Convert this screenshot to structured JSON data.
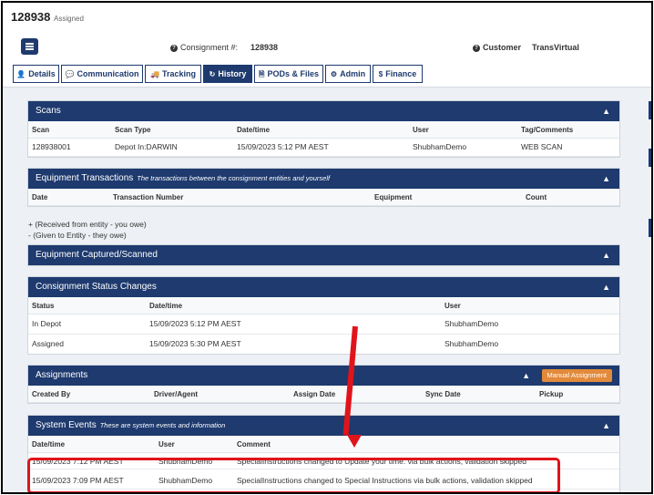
{
  "header": {
    "consignment_id": "128938",
    "status": "Assigned",
    "consignment_label": "Consignment #:",
    "consignment_value": "128938",
    "customer_label": "Customer",
    "customer_value": "TransVirtual"
  },
  "tabs": [
    {
      "icon": "user-icon",
      "glyph": "👤",
      "label": "Details"
    },
    {
      "icon": "chat-icon",
      "glyph": "💬",
      "label": "Communication"
    },
    {
      "icon": "truck-icon",
      "glyph": "🚚",
      "label": "Tracking"
    },
    {
      "icon": "history-icon",
      "glyph": "↻",
      "label": "History"
    },
    {
      "icon": "document-icon",
      "glyph": "🗎",
      "label": "PODs & Files"
    },
    {
      "icon": "gear-icon",
      "glyph": "⚙",
      "label": "Admin"
    },
    {
      "icon": "dollar-icon",
      "glyph": "$",
      "label": "Finance"
    }
  ],
  "active_tab": "History",
  "scans": {
    "title": "Scans",
    "columns": [
      "Scan",
      "Scan Type",
      "Date/time",
      "User",
      "Tag/Comments"
    ],
    "rows": [
      [
        "128938001",
        "Depot In:DARWIN",
        "15/09/2023 5:12 PM AEST",
        "ShubhamDemo",
        "WEB SCAN"
      ]
    ]
  },
  "equipment": {
    "title": "Equipment Transactions",
    "subtitle": "The transactions between the consignment entities and yourself",
    "columns": [
      "Date",
      "Transaction Number",
      "Equipment",
      "Count"
    ]
  },
  "notes": {
    "received": "+ (Received from entity - you owe)",
    "given": "- (Given to Entity - they owe)"
  },
  "equipment_captured": {
    "title": "Equipment Captured/Scanned"
  },
  "status_changes": {
    "title": "Consignment Status Changes",
    "columns": [
      "Status",
      "Date/time",
      "User"
    ],
    "rows": [
      [
        "In Depot",
        "15/09/2023 5:12 PM AEST",
        "ShubhamDemo"
      ],
      [
        "Assigned",
        "15/09/2023 5:30 PM AEST",
        "ShubhamDemo"
      ]
    ]
  },
  "assignments": {
    "title": "Assignments",
    "button": "Manual Assignment",
    "columns": [
      "Created By",
      "Driver/Agent",
      "Assign Date",
      "Sync Date",
      "Pickup"
    ]
  },
  "system_events": {
    "title": "System Events",
    "subtitle": "These are system events and information",
    "columns": [
      "Date/time",
      "User",
      "Comment"
    ],
    "rows": [
      [
        "15/09/2023 7:12 PM AEST",
        "ShubhamDemo",
        "SpecialInstructions changed to Update your time. via bulk actions, validation skipped"
      ],
      [
        "15/09/2023 7:09 PM AEST",
        "ShubhamDemo",
        "SpecialInstructions changed to Special Instructions via bulk actions, validation skipped"
      ]
    ]
  },
  "annotation_color": "#e0141b",
  "accent_color": "#1e3a6e",
  "button_color": "#e28a3b"
}
